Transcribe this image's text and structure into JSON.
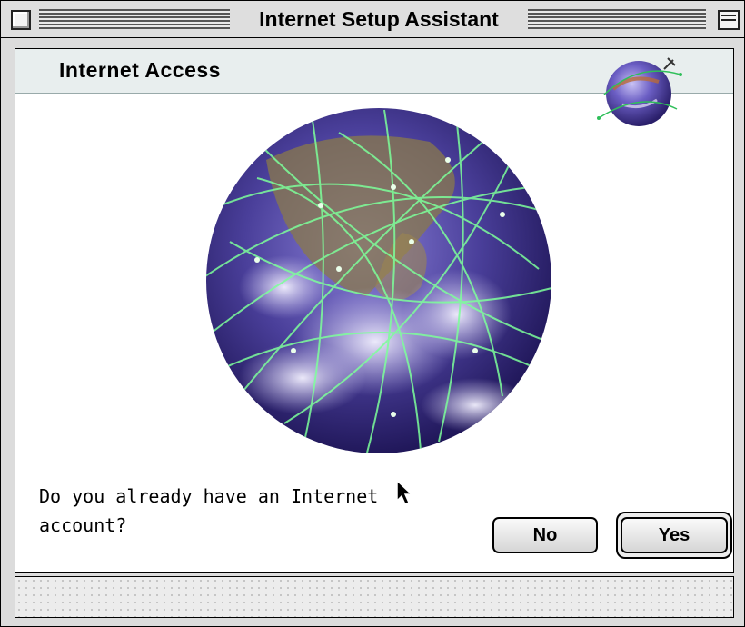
{
  "window": {
    "title": "Internet Setup Assistant"
  },
  "header": {
    "title": "Internet Access"
  },
  "main": {
    "question_line1": "Do you already have an Internet",
    "question_line2": "account?"
  },
  "buttons": {
    "no_label": "No",
    "yes_label": "Yes"
  },
  "icons": [
    "close-box-icon",
    "collapse-box-icon",
    "internet-globe-icon",
    "earth-network-globe-icon",
    "arrow-cursor-icon"
  ],
  "colors": {
    "header_band": "#e8eeee",
    "network_lines": "#7dff9a",
    "globe_ocean": "#4a3f9a"
  }
}
